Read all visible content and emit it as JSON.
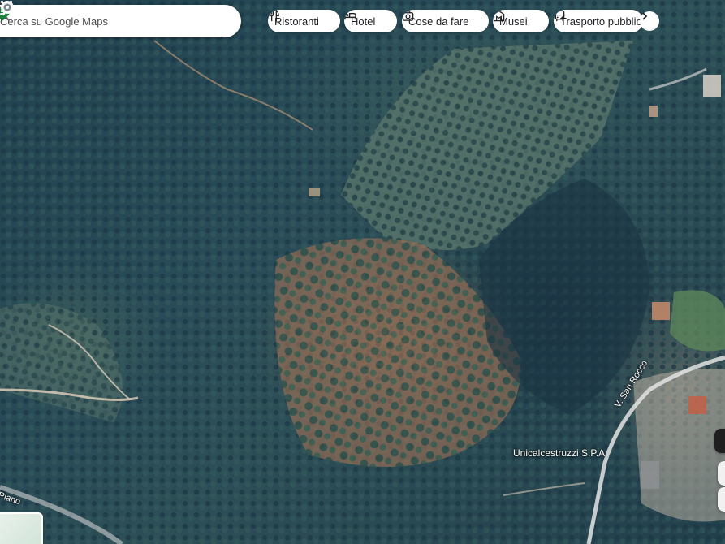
{
  "search": {
    "placeholder": "Cerca su Google Maps"
  },
  "chips": [
    {
      "label": "Ristoranti",
      "icon": "fork-knife-icon"
    },
    {
      "label": "Hotel",
      "icon": "bed-icon"
    },
    {
      "label": "Cose da fare",
      "icon": "camera-icon"
    },
    {
      "label": "Musei",
      "icon": "museum-icon"
    },
    {
      "label": "Trasporto pubblico",
      "icon": "bus-icon"
    }
  ],
  "map": {
    "place_label": "Unicalcestruzzi S.P.A",
    "road_label_1": "V. San Rocco",
    "road_label_2": "Piano"
  },
  "colors": {
    "accent": "#188038",
    "chip_bg": "#ffffff"
  }
}
